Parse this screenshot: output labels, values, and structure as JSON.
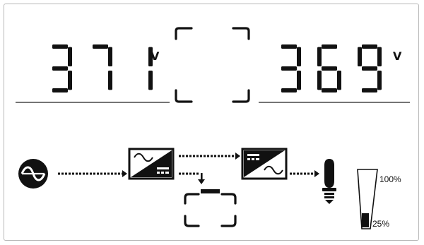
{
  "display": {
    "input_voltage": "371",
    "input_unit": "V",
    "output_voltage": "369",
    "output_unit": "V"
  },
  "battery_level": {
    "max_label": "100%",
    "min_label": "25%",
    "level_percent": 25
  },
  "colors": {
    "segment": "#111111",
    "background": "#ffffff"
  },
  "icons": {
    "ac_source": "sine-wave-icon",
    "rectifier": "ac-to-dc-icon",
    "inverter": "dc-to-ac-icon",
    "battery": "battery-icon",
    "load": "light-bulb-icon"
  }
}
